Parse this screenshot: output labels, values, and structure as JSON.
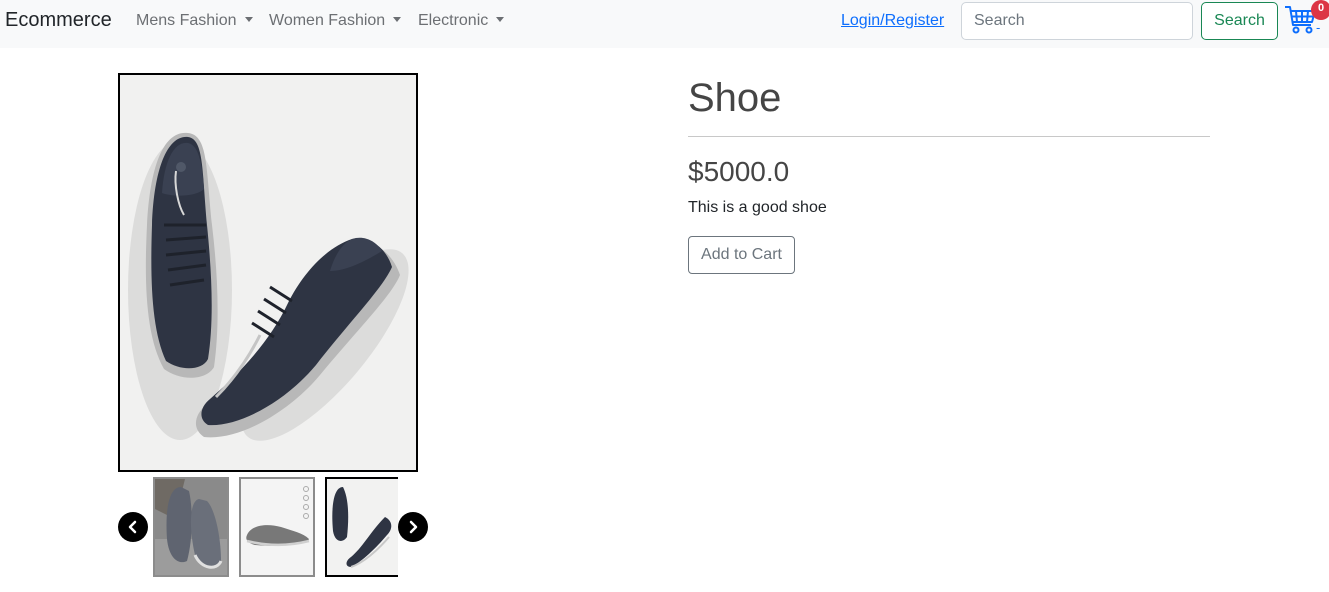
{
  "navbar": {
    "brand": "Ecommerce",
    "menus": [
      {
        "label": "Mens Fashion"
      },
      {
        "label": "Women Fashion"
      },
      {
        "label": "Electronic"
      }
    ],
    "login_label": "Login/Register",
    "search_placeholder": "Search",
    "search_button": "Search",
    "cart_count": "0",
    "cart_dash": "-"
  },
  "product": {
    "title": "Shoe",
    "price": "$5000.0",
    "description": "This is a good shoe",
    "add_to_cart": "Add to Cart",
    "thumbnails": [
      {
        "name": "thumbnail-1",
        "active": false
      },
      {
        "name": "thumbnail-2",
        "active": false
      },
      {
        "name": "thumbnail-3",
        "active": true
      }
    ]
  },
  "colors": {
    "navbar_bg": "#f8f9fa",
    "link": "#0d6efd",
    "success": "#198754",
    "badge": "#dc3545",
    "shoe": "#2e3443"
  },
  "icons": [
    "caret-down-icon",
    "cart-icon",
    "chevron-left-icon",
    "chevron-right-icon"
  ]
}
